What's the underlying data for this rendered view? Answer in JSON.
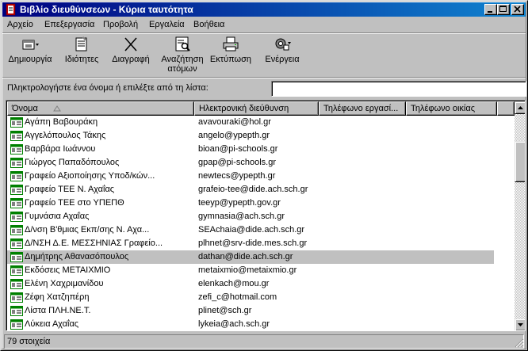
{
  "window": {
    "title": "Βιβλίο διευθύνσεων - Κύρια ταυτότητα"
  },
  "menu": [
    {
      "label": "Αρχείο"
    },
    {
      "label": "Επεξεργασία"
    },
    {
      "label": "Προβολή"
    },
    {
      "label": "Εργαλεία"
    },
    {
      "label": "Βοήθεια"
    }
  ],
  "toolbar": {
    "new_label": "Δημιουργία",
    "properties_label": "Ιδιότητες",
    "delete_label": "Διαγραφή",
    "find_label_1": "Αναζήτηση",
    "find_label_2": "ατόμων",
    "print_label": "Εκτύπωση",
    "action_label": "Ενέργεια"
  },
  "search": {
    "label": "Πληκτρολογήστε ένα όνομα ή επιλέξτε από τη λίστα:",
    "value": ""
  },
  "columns": {
    "name": "Όνομα",
    "email": "Ηλεκτρονική διεύθυνση",
    "work_phone": "Τηλέφωνο εργασί...",
    "home_phone": "Τηλέφωνο οικίας"
  },
  "contacts": [
    {
      "name": "Αγάπη Βαβουράκη",
      "email": "avavouraki@hol.gr"
    },
    {
      "name": "Αγγελόπουλος Τάκης",
      "email": "angelo@ypepth.gr"
    },
    {
      "name": "Βαρβάρα Ιωάννου",
      "email": "bioan@pi-schools.gr"
    },
    {
      "name": "Γιώργος Παπαδόπουλος",
      "email": "gpap@pi-schools.gr"
    },
    {
      "name": "Γραφείο Αξιοποίησης Υποδ/κών...",
      "email": "newtecs@ypepth.gr"
    },
    {
      "name": "Γραφείο ΤΕΕ Ν. Αχαΐας",
      "email": "grafeio-tee@dide.ach.sch.gr"
    },
    {
      "name": "Γραφείο ΤΕΕ στο ΥΠΕΠΘ",
      "email": "teeyp@ypepth.gov.gr"
    },
    {
      "name": "Γυμνάσια Αχαΐας",
      "email": "gymnasia@ach.sch.gr"
    },
    {
      "name": "Δ/νση Β'θμιας Εκπ/σης Ν. Αχα...",
      "email": "SEAchaia@dide.ach.sch.gr"
    },
    {
      "name": "Δ/ΝΣΗ Δ.Ε. ΜΕΣΣΗΝΙΑΣ Γραφείο...",
      "email": "plhnet@srv-dide.mes.sch.gr"
    },
    {
      "name": "Δημήτρης Αθανασόπουλος",
      "email": "dathan@dide.ach.sch.gr"
    },
    {
      "name": "Εκδόσεις ΜΕΤΑΙΧΜΙΟ",
      "email": "metaixmio@metaixmio.gr"
    },
    {
      "name": "Ελένη Χαχριμανίδου",
      "email": "elenkach@mou.gr"
    },
    {
      "name": "Ζέφη Χατζηπέρη",
      "email": "zefi_c@hotmail.com"
    },
    {
      "name": "Λίστα ΠΛΗ.ΝΕ.Τ.",
      "email": "plinet@sch.gr"
    },
    {
      "name": "Λύκεια Αχαΐας",
      "email": "lykeia@ach.sch.gr"
    }
  ],
  "selected_index": 10,
  "status": {
    "text": "79 στοιχεία"
  },
  "colors": {
    "titlebar_start": "#000080",
    "titlebar_end": "#1084d0",
    "face": "#c0c0c0"
  },
  "icons": {
    "contact": "contact-card-icon"
  }
}
